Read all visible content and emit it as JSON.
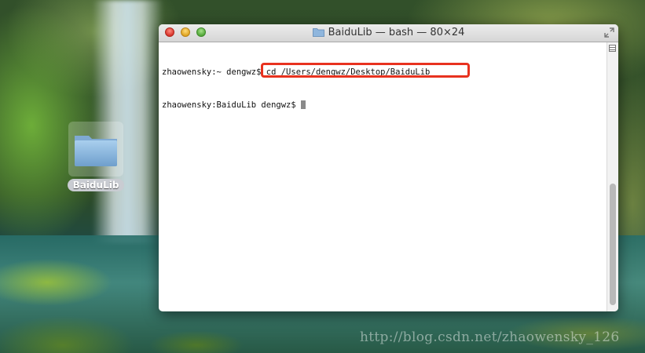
{
  "window": {
    "title": "BaiduLib — bash — 80×24",
    "title_icon": "folder-icon"
  },
  "terminal": {
    "lines": [
      {
        "prompt": "zhaowensky:~ dengwz$ ",
        "command": "cd /Users/dengwz/Desktop/BaiduLib"
      },
      {
        "prompt": "zhaowensky:BaiduLib dengwz$ ",
        "command": ""
      }
    ],
    "highlight_color": "#e8321f"
  },
  "desktop": {
    "folder_label": "BaiduLib",
    "watermark": "http://blog.csdn.net/zhaowensky_126"
  }
}
